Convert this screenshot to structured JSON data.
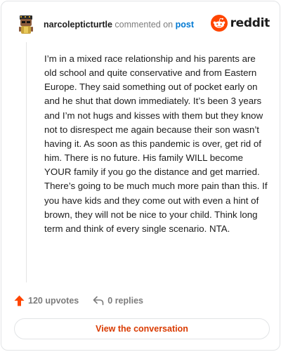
{
  "header": {
    "username": "narcolepticturtle",
    "commented_text": "commented on",
    "post_link": "post",
    "logo_text": "reddit"
  },
  "comment": {
    "body": "I’m in a mixed race relationship and his parents are old school and quite conservative and from Eastern Europe. They said something out of pocket early on and he shut that down immediately. It’s been 3 years and I’m not hugs and kisses with them but they know not to disrespect me again because their son wasn’t having it. As soon as this pandemic is over, get rid of him. There is no future. His family WILL become YOUR family if you go the distance and get married. There’s going to be much much more pain than this. If you have kids and they come out with even a hint of brown, they will not be nice to your child. Think long term and think of every single scenario. NTA."
  },
  "footer": {
    "upvotes": "120 upvotes",
    "replies": "0 replies"
  },
  "actions": {
    "view_conversation": "View the conversation"
  },
  "colors": {
    "brand": "#ff4500",
    "link": "#0079d3",
    "cta_text": "#d93a00",
    "muted": "#7c7c7c"
  },
  "icons": {
    "avatar": "snoo-avatar-icon",
    "logo": "reddit-snoo-icon",
    "upvote": "upvote-arrow-icon",
    "reply": "reply-arrow-icon"
  }
}
